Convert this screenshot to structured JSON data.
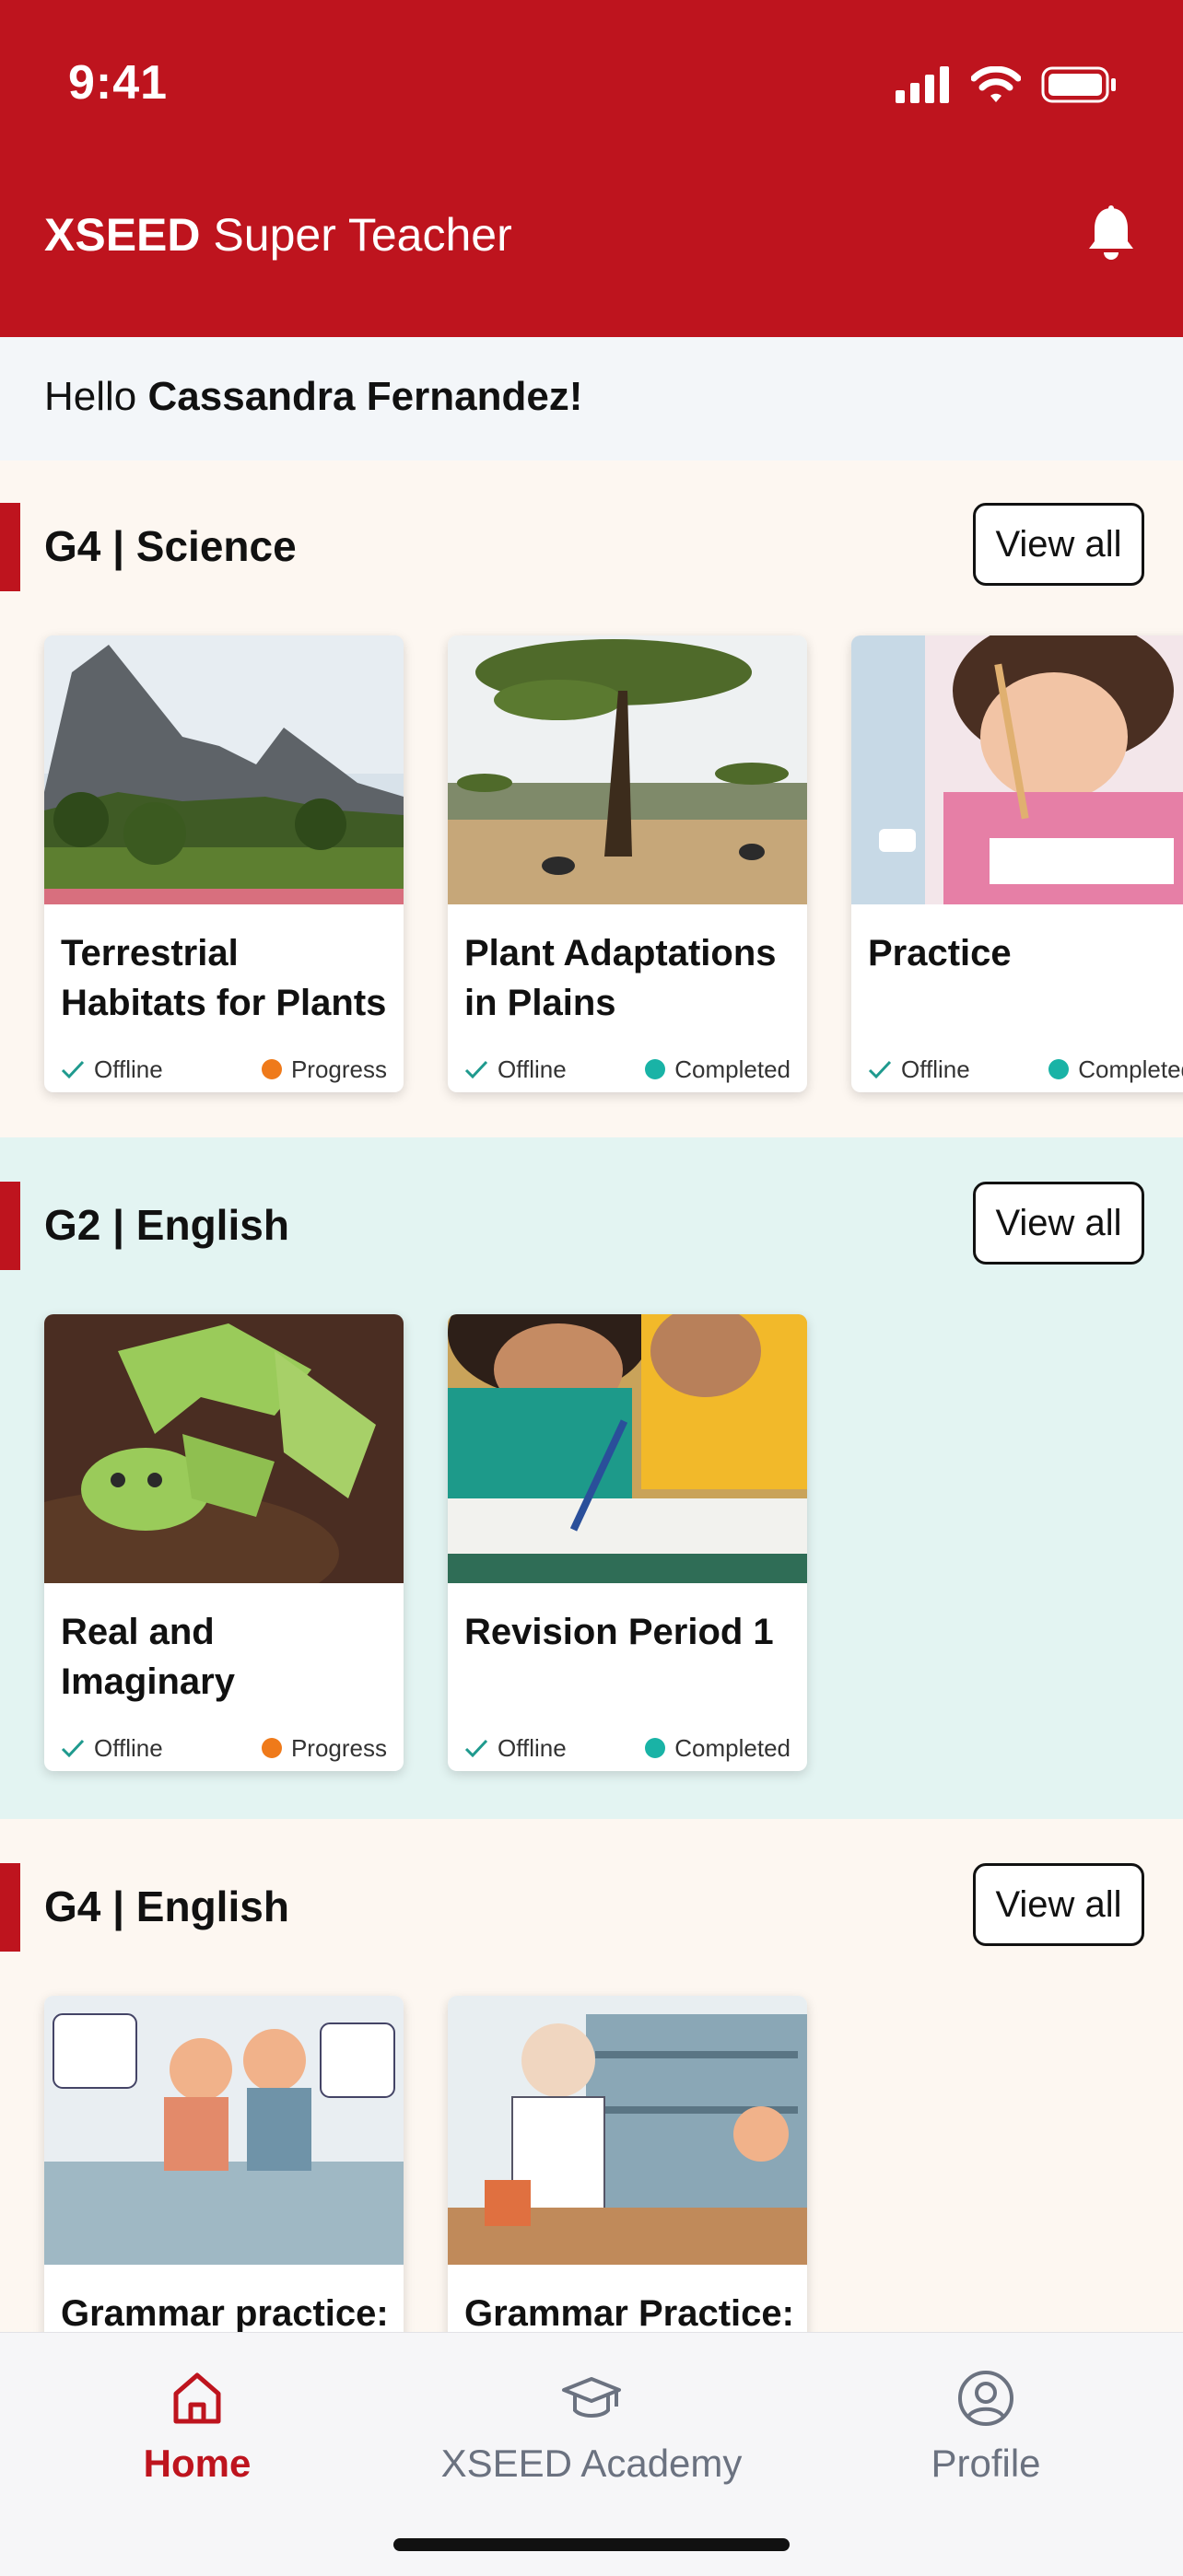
{
  "status_bar": {
    "time": "9:41"
  },
  "header": {
    "brand": "XSEED",
    "title": "Super Teacher"
  },
  "greeting": {
    "prefix": "Hello",
    "name": "Cassandra Fernandez!"
  },
  "sections": [
    {
      "title": "G4 | Science",
      "view_all": "View all",
      "cards": [
        {
          "title": "Terrestrial Habitats for Plants",
          "offline": "Offline",
          "status": "Progress",
          "status_color": "#ef7a1a"
        },
        {
          "title": "Plant Adaptations in Plains",
          "offline": "Offline",
          "status": "Completed",
          "status_color": "#19b3a6"
        },
        {
          "title": "Practice",
          "offline": "Offline",
          "status": "Completed",
          "status_color": "#19b3a6"
        }
      ]
    },
    {
      "title": "G2 | English",
      "view_all": "View all",
      "cards": [
        {
          "title": "Real and Imaginary",
          "offline": "Offline",
          "status": "Progress",
          "status_color": "#ef7a1a"
        },
        {
          "title": "Revision Period 1",
          "offline": "Offline",
          "status": "Completed",
          "status_color": "#19b3a6"
        }
      ]
    },
    {
      "title": "G4 | English",
      "view_all": "View all",
      "cards": [
        {
          "title": "Grammar practice:"
        },
        {
          "title": "Grammar Practice:"
        }
      ]
    }
  ],
  "bottom_nav": [
    {
      "label": "Home",
      "icon": "home-icon",
      "active": true
    },
    {
      "label": "XSEED Academy",
      "icon": "graduation-cap-icon",
      "active": false
    },
    {
      "label": "Profile",
      "icon": "profile-icon",
      "active": false
    }
  ],
  "colors": {
    "brand_red": "#be141e",
    "progress": "#ef7a1a",
    "completed": "#19b3a6",
    "check_green": "#1f9a8e",
    "section_cream": "#fdf7f1",
    "section_mint": "#e3f4f2",
    "nav_inactive": "#6b7280"
  }
}
